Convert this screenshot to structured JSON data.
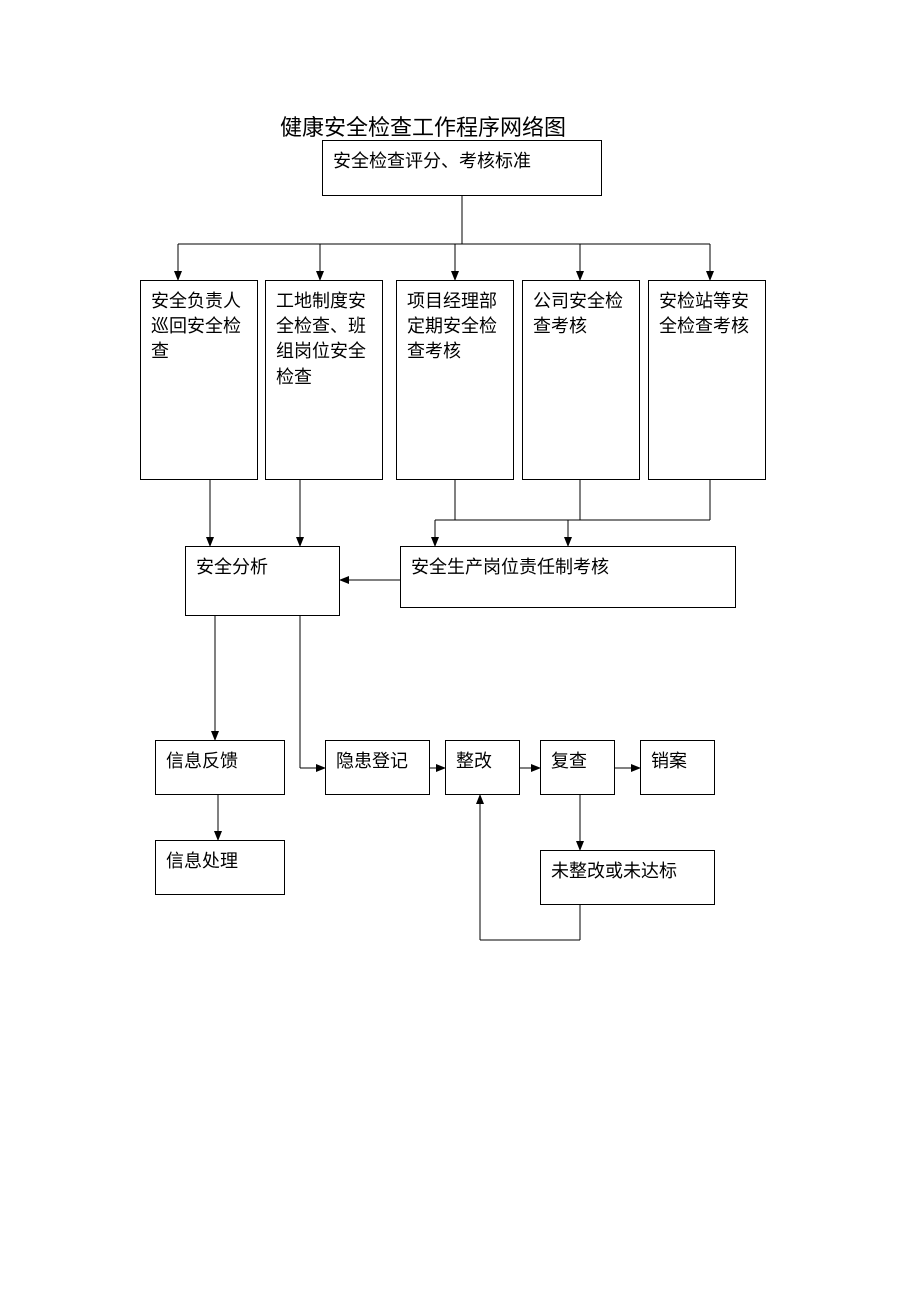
{
  "title": "健康安全检查工作程序网络图",
  "nodes": {
    "top": "安全检查评分、考核标准",
    "r1_1": "安全负责人巡回安全检查",
    "r1_2": "工地制度安全检查、班组岗位安全检查",
    "r1_3": "项目经理部定期安全检查考核",
    "r1_4": "公司安全检查考核",
    "r1_5": "安检站等安全检查考核",
    "analysis": "安全分析",
    "responsibility": "安全生产岗位责任制考核",
    "feedback": "信息反馈",
    "hazard": "隐患登记",
    "rectify": "整改",
    "recheck": "复查",
    "close": "销案",
    "process": "信息处理",
    "notmet": "未整改或未达标"
  }
}
